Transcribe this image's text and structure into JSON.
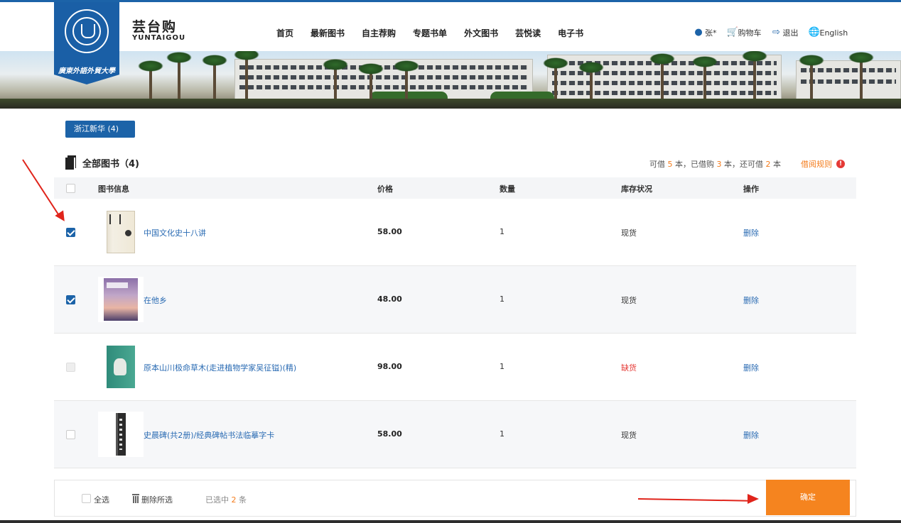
{
  "header": {
    "brand_cn": "芸台购",
    "brand_en": "YUNTAIGOU",
    "school_name": "廣東外語外貿大學",
    "nav": [
      "首页",
      "最新图书",
      "自主荐购",
      "专题书单",
      "外文图书",
      "芸悦读",
      "电子书"
    ],
    "user": "张*",
    "cart": "购物车",
    "logout": "退出",
    "language": "English",
    "accent_color": "#1c63a8"
  },
  "vendor_tab": "浙江新华 (4)",
  "section": {
    "title": "全部图书（4)",
    "quota_prefix": "可借",
    "quota_borrowable": "5",
    "quota_mid1": "本，已借购",
    "quota_borrowed": "3",
    "quota_mid2": "本，还可借",
    "quota_remaining": "2",
    "quota_suffix": "本",
    "rules_label": "借阅规则",
    "rules_icon": "!"
  },
  "table": {
    "headers": {
      "info": "图书信息",
      "price": "价格",
      "qty": "数量",
      "stock": "库存状况",
      "action": "操作"
    },
    "rows": [
      {
        "title": "中国文化史十八讲",
        "price": "58.00",
        "qty": "1",
        "stock": "现货",
        "action": "删除",
        "checked": true
      },
      {
        "title": "在他乡",
        "price": "48.00",
        "qty": "1",
        "stock": "现货",
        "action": "删除",
        "checked": true
      },
      {
        "title": "原本山川极命草木(走进植物学家吴征镒)(精)",
        "price": "98.00",
        "qty": "1",
        "stock": "缺货",
        "action": "删除",
        "checked": false
      },
      {
        "title": "史晨碑(共2册)/经典碑帖书法临摹字卡",
        "price": "58.00",
        "qty": "1",
        "stock": "现货",
        "action": "删除",
        "checked": false
      }
    ]
  },
  "footer": {
    "select_all": "全选",
    "delete_selected": "删除所选",
    "selected_prefix": "已选中",
    "selected_count": "2",
    "selected_suffix": "条",
    "confirm": "确定"
  }
}
